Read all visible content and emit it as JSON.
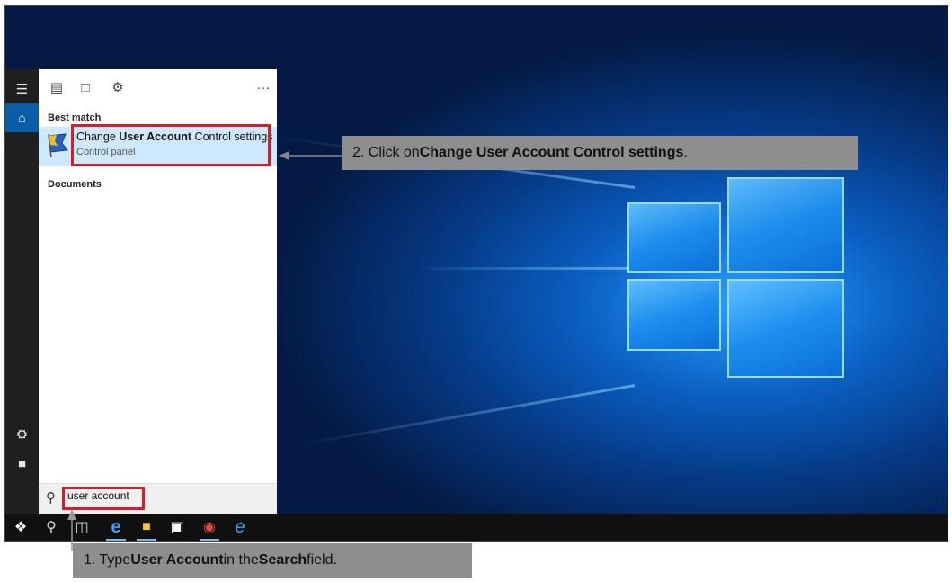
{
  "start_menu": {
    "rail": {
      "menu_icon": "hamburger-icon",
      "home_icon": "home-icon",
      "settings_icon": "gear-icon",
      "power_icon": "user-icon"
    },
    "toolbar": {
      "apps_icon": "apps-icon",
      "documents_icon": "document-icon",
      "settings_icon": "gear-icon",
      "more_label": "···"
    },
    "best_match_heading": "Best match",
    "best_match": {
      "title_pre": "Change ",
      "title_bold": "User Account",
      "title_post": " Control settings",
      "subtitle": "Control panel"
    },
    "documents_heading": "Documents",
    "search": {
      "value": "user account"
    }
  },
  "taskbar": {
    "items": [
      "windows-logo-icon",
      "search-icon",
      "task-view-icon",
      "edge-icon",
      "file-explorer-icon",
      "store-icon",
      "chrome-icon",
      "internet-explorer-icon"
    ]
  },
  "callouts": {
    "step2": {
      "pre": "2. Click on ",
      "bold": "Change User Account Control settings",
      "post": "."
    },
    "step1": {
      "pre": "1. Type ",
      "bold1": "User Account",
      "mid": " in the ",
      "bold2": "Search",
      "post": " field."
    }
  },
  "colors": {
    "highlight": "#d0202e",
    "selection": "#cde8ff",
    "callout": "#8e8e8e"
  }
}
